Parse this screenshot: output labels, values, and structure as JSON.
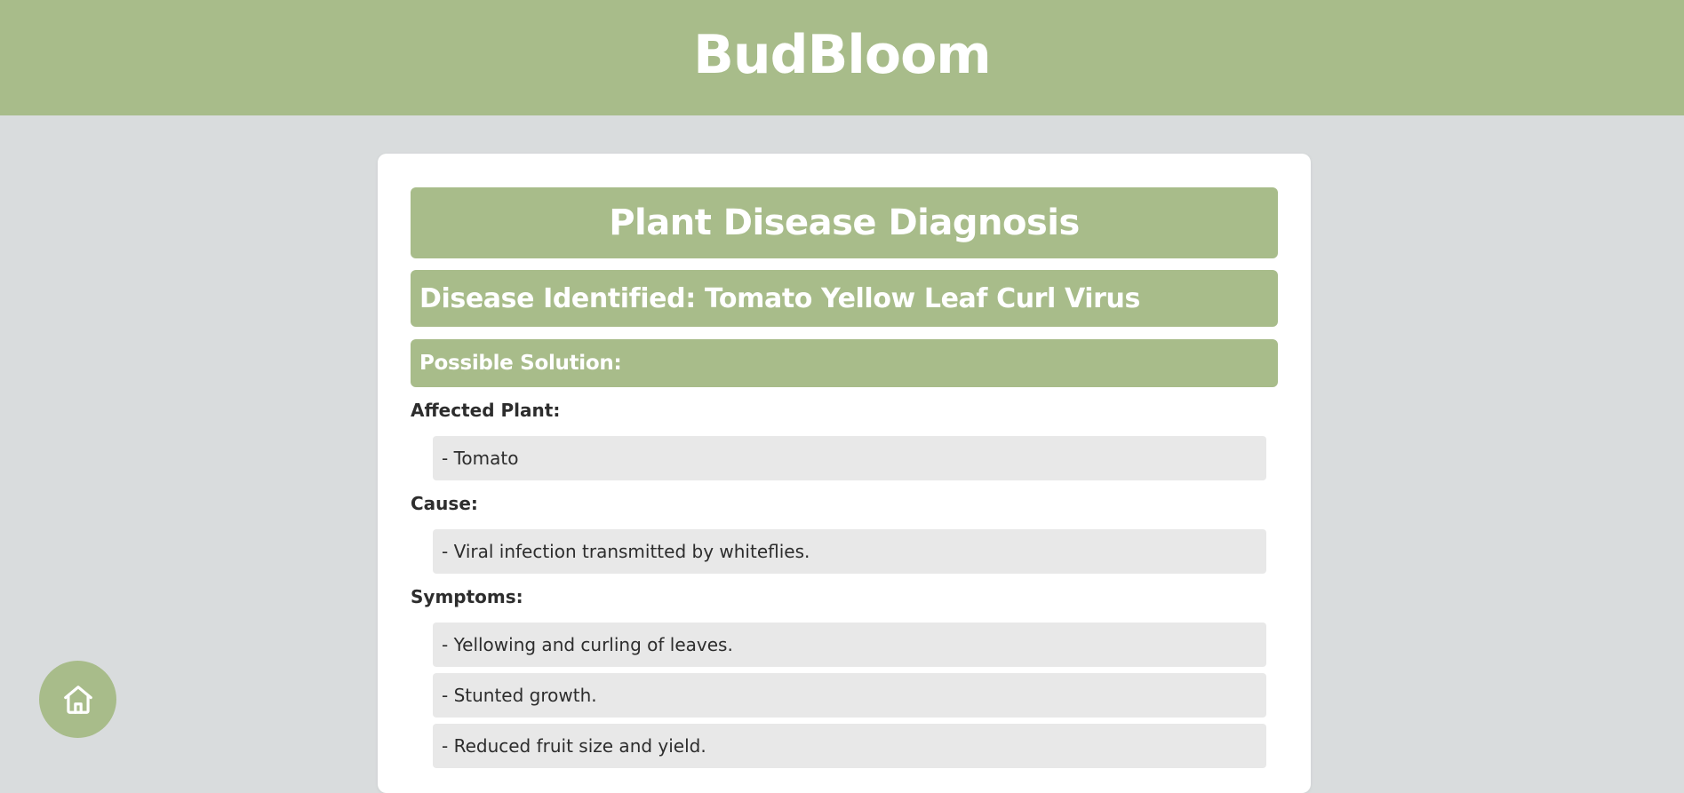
{
  "app": {
    "brand": "BudBloom"
  },
  "diagnosis": {
    "title": "Plant Disease Diagnosis",
    "disease": "Disease Identified: Tomato Yellow Leaf Curl Virus",
    "solution_heading": "Possible Solution:"
  },
  "sections": {
    "affected_plant": {
      "label": "Affected Plant:",
      "items": [
        "- Tomato"
      ]
    },
    "cause": {
      "label": "Cause:",
      "items": [
        "- Viral infection transmitted by whiteflies."
      ]
    },
    "symptoms": {
      "label": "Symptoms:",
      "items": [
        "- Yellowing and curling of leaves.",
        "- Stunted growth.",
        "- Reduced fruit size and yield."
      ]
    }
  },
  "nav": {
    "home_icon": "home-icon"
  },
  "colors": {
    "accent": "#a8bc8a",
    "background": "#d9dcdd",
    "card": "#ffffff",
    "item_background": "#e8e8e8",
    "text": "#2d2d2d"
  }
}
